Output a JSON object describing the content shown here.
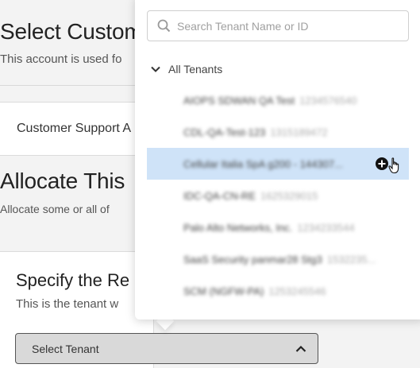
{
  "background": {
    "section1_title": "Select Custom",
    "section1_subtitle": "This account is used fo",
    "card_label": "Customer Support A",
    "section2_title": "Allocate This",
    "section2_subtitle": "Allocate some or all of",
    "card2_title": "Specify the Re",
    "card2_subtitle": "This is the tenant w",
    "select_tenant_label": "Select Tenant"
  },
  "dropdown": {
    "search_placeholder": "Search Tenant Name or ID",
    "group_label": "All Tenants",
    "tenants": [
      {
        "name": "AIOPS SDWAN QA Test",
        "id": "1234576540"
      },
      {
        "name": "CDL-QA-Test-123",
        "id": "1315189472"
      },
      {
        "name": "Cellular Italia SpA g200 - 144307...",
        "id": ""
      },
      {
        "name": "IDC-QA-CN-RE",
        "id": "1625329015"
      },
      {
        "name": "Palo Alto Networks, Inc.",
        "id": "1234233544"
      },
      {
        "name": "SaaS Security panmar28 Stg3",
        "id": "1532235..."
      },
      {
        "name": "SCM (NGFW-PA)",
        "id": "1253245546"
      }
    ],
    "selected_index": 2
  },
  "colors": {
    "selected_row": "#cfe3f8",
    "page_bg": "#f3f3f3",
    "select_bg": "#d9d9d9"
  },
  "icons": {
    "search": "search-icon",
    "expand": "chevron-down-icon",
    "add": "plus-circle-icon",
    "cursor": "hand-pointer-icon",
    "select_toggle": "chevron-up-icon"
  }
}
